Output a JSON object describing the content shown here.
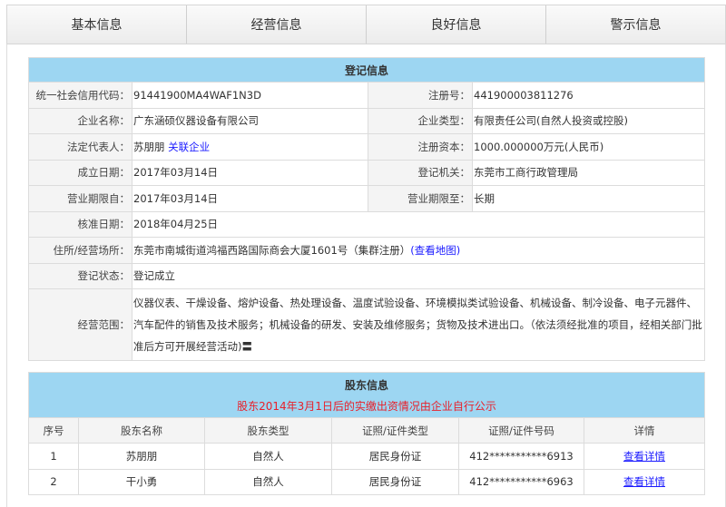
{
  "tabs": [
    "基本信息",
    "经营信息",
    "良好信息",
    "警示信息"
  ],
  "registration": {
    "title": "登记信息",
    "credit_code_label": "统一社会信用代码：",
    "credit_code": "91441900MA4WAF1N3D",
    "reg_no_label": "注册号：",
    "reg_no": "441900003811276",
    "name_label": "企业名称：",
    "name": "广东涵硕仪器设备有限公司",
    "type_label": "企业类型：",
    "type": "有限责任公司(自然人投资或控股)",
    "legal_rep_label": "法定代表人：",
    "legal_rep": "苏朋朋",
    "related_link": "关联企业",
    "capital_label": "注册资本：",
    "capital": "1000.000000万元(人民币)",
    "founded_label": "成立日期：",
    "founded": "2017年03月14日",
    "authority_label": "登记机关：",
    "authority": "东莞市工商行政管理局",
    "term_from_label": "营业期限自：",
    "term_from": "2017年03月14日",
    "term_to_label": "营业期限至：",
    "term_to": "长期",
    "approved_label": "核准日期：",
    "approved": "2018年04月25日",
    "address_label": "住所/经营场所：",
    "address": "东莞市南城街道鸿福西路国际商会大厦1601号（集群注册）",
    "map_link": "(查看地图)",
    "status_label": "登记状态：",
    "status": "登记成立",
    "scope_label": "经营范围：",
    "scope": "仪器仪表、干燥设备、熔炉设备、热处理设备、温度试验设备、环境模拟类试验设备、机械设备、制冷设备、电子元器件、汽车配件的销售及技术服务；机械设备的研发、安装及维修服务；货物及技术进出口。（依法须经批准的项目，经相关部门批准后方可开展经营活动)〓"
  },
  "shareholders": {
    "title": "股东信息",
    "notice": "股东2014年3月1日后的实缴出资情况由企业自行公示",
    "columns": [
      "序号",
      "股东名称",
      "股东类型",
      "证照/证件类型",
      "证照/证件号码",
      "详情"
    ],
    "rows": [
      {
        "no": "1",
        "name": "苏朋朋",
        "type": "自然人",
        "id_type": "居民身份证",
        "id_no": "412***********6913",
        "detail": "查看详情"
      },
      {
        "no": "2",
        "name": "干小勇",
        "type": "自然人",
        "id_type": "居民身份证",
        "id_no": "412***********6963",
        "detail": "查看详情"
      }
    ]
  }
}
